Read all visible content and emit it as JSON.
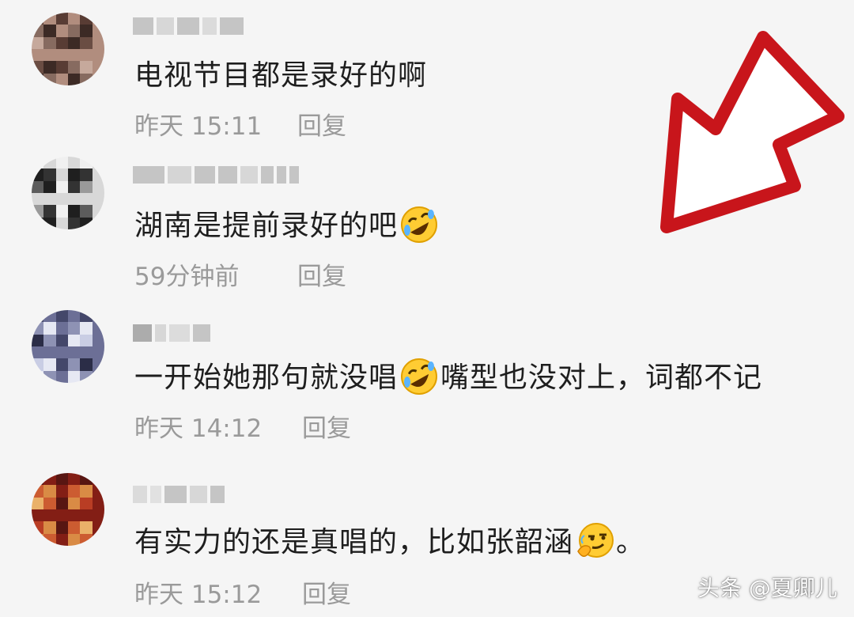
{
  "comments": [
    {
      "avatar_colors": [
        "#5a3b33",
        "#8a6a5e",
        "#c9a89a",
        "#b48c7c",
        "#6d4c41",
        "#3e2a24"
      ],
      "text": "电视节目都是录好的啊",
      "time": "昨天 15:11",
      "reply": "回复"
    },
    {
      "avatar_colors": [
        "#1f1f1f",
        "#5c5c5c",
        "#d8d8d8",
        "#9a9a9a",
        "#333333",
        "#f0f0f0"
      ],
      "text": "湖南是提前录好的吧",
      "emoji": "rolling-laughing-emoji",
      "time": "59分钟前",
      "reply": "回复"
    },
    {
      "avatar_colors": [
        "#2b2d4a",
        "#6b6f9a",
        "#c8cde6",
        "#e6e8f4",
        "#43476e",
        "#8d92b8"
      ],
      "text_part1": "一开始她那句就没唱",
      "emoji": "rolling-laughing-emoji",
      "text_part2": "嘴型也没对上，词都不记",
      "time": "昨天 14:12",
      "reply": "回复"
    },
    {
      "avatar_colors": [
        "#8c1c12",
        "#c43a1f",
        "#e08a3c",
        "#5e1410",
        "#d65a2a",
        "#f0b060"
      ],
      "text": "有实力的还是真唱的，比如张韶涵",
      "emoji": "thinking-smirk-emoji",
      "text_end": "。",
      "time": "昨天 15:12",
      "reply": "回复"
    }
  ],
  "annotation": {
    "arrow_color": "#c8151b"
  },
  "watermark": "头条 @夏卿儿"
}
